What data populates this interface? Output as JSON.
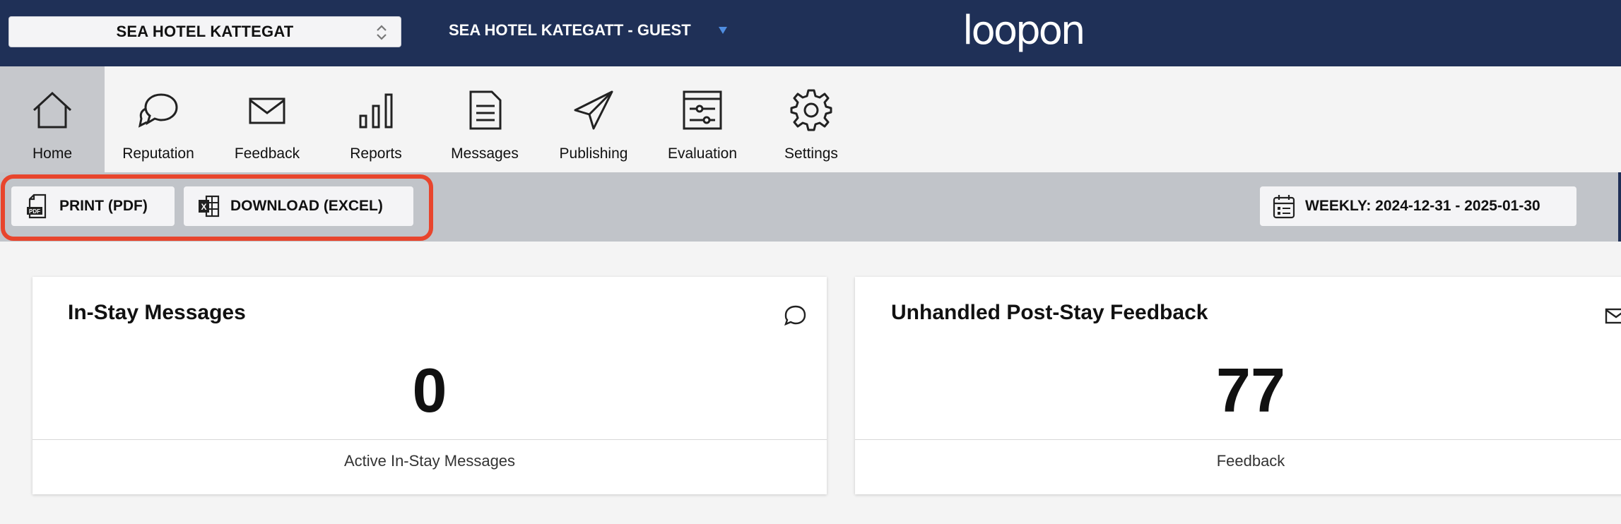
{
  "header": {
    "hotel_select_value": "SEA HOTEL KATTEGAT",
    "guest_label": "SEA HOTEL KATEGATT - GUEST",
    "logo_text": "loopon",
    "background_color": "#1f3057"
  },
  "nav": {
    "items": [
      {
        "label": "Home",
        "icon": "home-icon",
        "active": true
      },
      {
        "label": "Reputation",
        "icon": "speech-bubbles-icon"
      },
      {
        "label": "Feedback",
        "icon": "envelope-icon"
      },
      {
        "label": "Reports",
        "icon": "bar-chart-icon"
      },
      {
        "label": "Messages",
        "icon": "document-icon"
      },
      {
        "label": "Publishing",
        "icon": "paper-plane-icon"
      },
      {
        "label": "Evaluation",
        "icon": "sliders-icon"
      },
      {
        "label": "Settings",
        "icon": "gear-icon"
      }
    ]
  },
  "toolbar": {
    "print_label": "PRINT (PDF)",
    "excel_label": "DOWNLOAD (EXCEL)",
    "date_range_label": "WEEKLY: 2024-12-31 - 2025-01-30",
    "highlight_color": "#e8452d"
  },
  "cards": [
    {
      "title": "In-Stay Messages",
      "value": "0",
      "footer": "Active In-Stay Messages",
      "icon": "speech-bubble-icon"
    },
    {
      "title": "Unhandled Post-Stay Feedback",
      "value": "77",
      "footer": "Feedback",
      "icon": "envelope-icon"
    }
  ]
}
